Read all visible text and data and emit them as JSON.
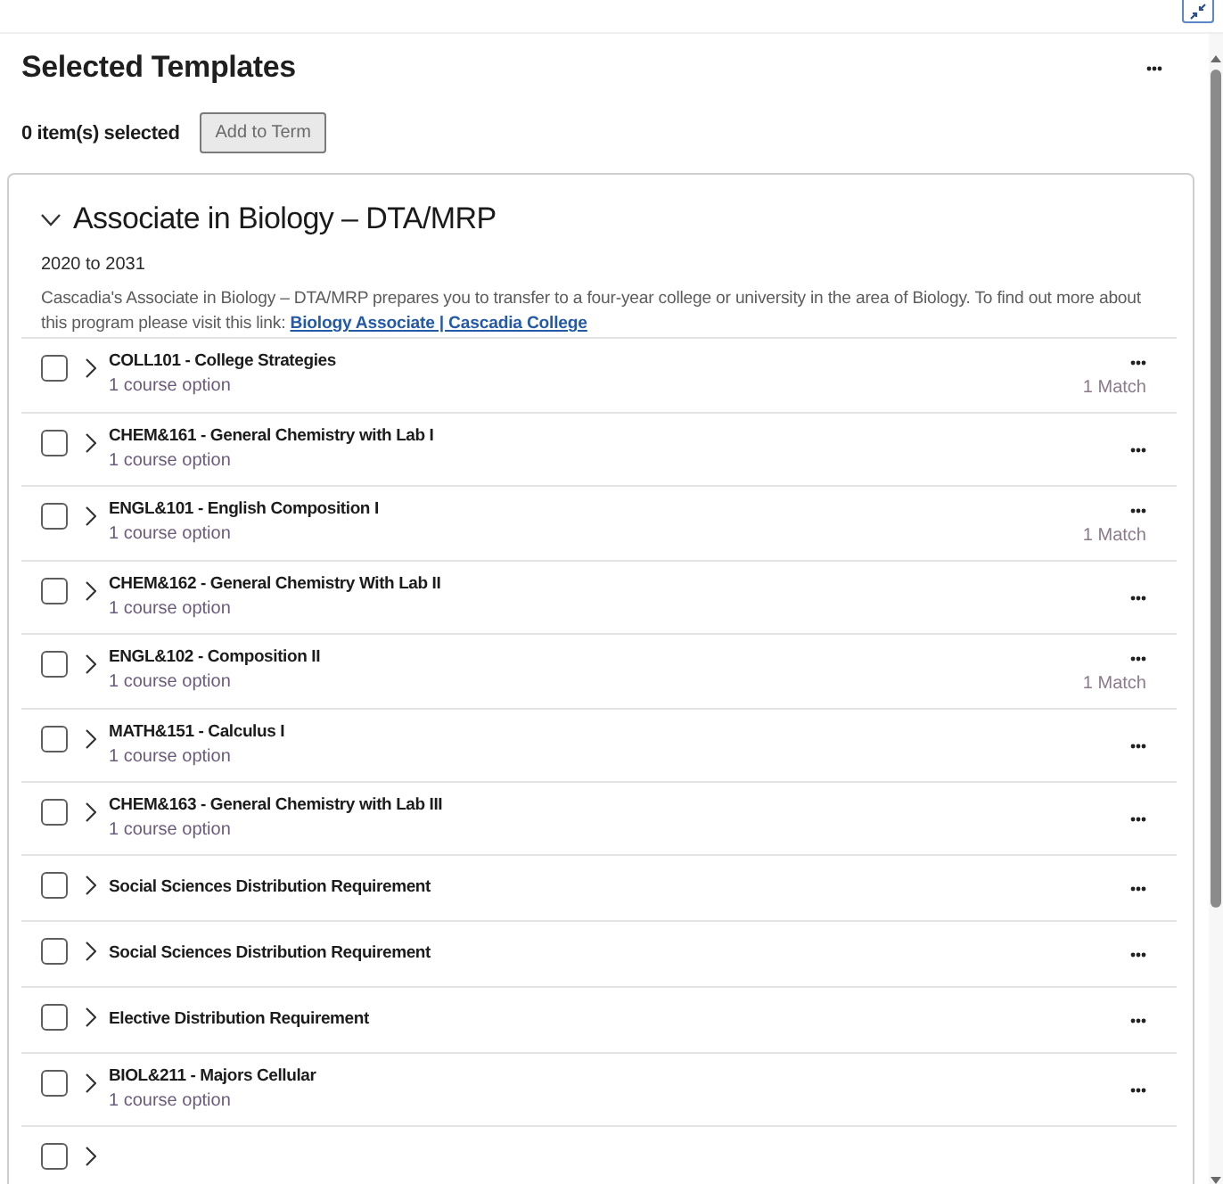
{
  "header": {
    "title": "Selected Templates",
    "selection_count": "0 item(s) selected",
    "add_button": {
      "label": "Add to Term",
      "disabled": true
    }
  },
  "program": {
    "title": "Associate in Biology – DTA/MRP",
    "expanded": true,
    "years": "2020 to 2031",
    "description": "Cascadia's Associate in Biology – DTA/MRP prepares you to transfer to a four-year college or university in the area of Biology. To find out more about this program please visit this link: ",
    "link": "Biology Associate | Cascadia College",
    "requirements": [
      {
        "title": "COLL101 - College Strategies",
        "subtitle": "1 course option",
        "match": "1 Match",
        "checked": false,
        "expanded": false
      },
      {
        "title": "CHEM&161 - General Chemistry with Lab I",
        "subtitle": "1 course option",
        "checked": false,
        "expanded": false
      },
      {
        "title": "ENGL&101 - English Composition I",
        "subtitle": "1 course option",
        "match": "1 Match",
        "checked": false,
        "expanded": false
      },
      {
        "title": "CHEM&162 - General Chemistry With Lab II",
        "subtitle": "1 course option",
        "checked": false,
        "expanded": false
      },
      {
        "title": "ENGL&102 - Composition II",
        "subtitle": "1 course option",
        "match": "1 Match",
        "checked": false,
        "expanded": false
      },
      {
        "title": "MATH&151 - Calculus I",
        "subtitle": "1 course option",
        "checked": false,
        "expanded": false
      },
      {
        "title": "CHEM&163 - General Chemistry with Lab III",
        "subtitle": "1 course option",
        "checked": false,
        "expanded": false
      },
      {
        "title": "Social Sciences Distribution Requirement",
        "checked": false,
        "expanded": false
      },
      {
        "title": "Social Sciences Distribution Requirement",
        "checked": false,
        "expanded": false
      },
      {
        "title": "Elective Distribution Requirement",
        "checked": false,
        "expanded": false
      },
      {
        "title": "BIOL&211 - Majors Cellular",
        "subtitle": "1 course option",
        "checked": false,
        "expanded": false
      },
      {
        "checked": false,
        "expanded": false
      }
    ]
  }
}
